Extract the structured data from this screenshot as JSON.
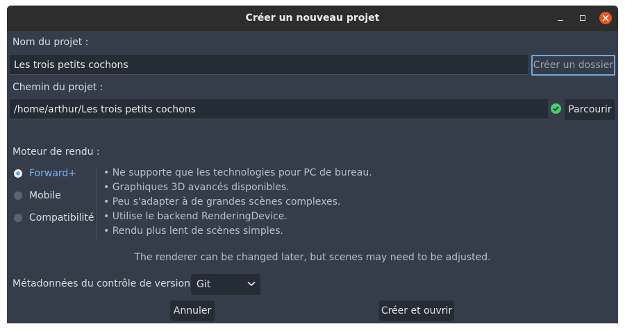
{
  "window": {
    "title": "Créer un nouveau projet"
  },
  "project_name": {
    "label": "Nom du projet :",
    "value": "Les trois petits cochons",
    "create_folder_label": "Créer un dossier"
  },
  "project_path": {
    "label": "Chemin du projet :",
    "value": "/home/arthur/Les trois petits cochons",
    "browse_label": "Parcourir",
    "status_icon": "check-circle-icon",
    "status_color": "#45d26e"
  },
  "renderer": {
    "label": "Moteur de rendu :",
    "options": [
      {
        "label": "Forward+",
        "selected": true
      },
      {
        "label": "Mobile",
        "selected": false
      },
      {
        "label": "Compatibilité",
        "selected": false
      }
    ],
    "description": [
      "•  Ne supporte que les technologies pour PC de bureau.",
      "•  Graphiques 3D avancés disponibles.",
      "•  Peu s'adapter à de grandes scènes complexes.",
      "•  Utilise le backend RenderingDevice.",
      "•  Rendu plus lent de scènes simples."
    ],
    "note": "The renderer can be changed later, but scenes may need to be adjusted."
  },
  "vcs": {
    "label": "Métadonnées du contrôle de version :",
    "value": "Git"
  },
  "actions": {
    "cancel_label": "Annuler",
    "create_label": "Créer et ouvrir"
  },
  "colors": {
    "accent": "#75b3f4",
    "panel": "#363d4a",
    "field": "#262c36",
    "close": "#e95420"
  }
}
